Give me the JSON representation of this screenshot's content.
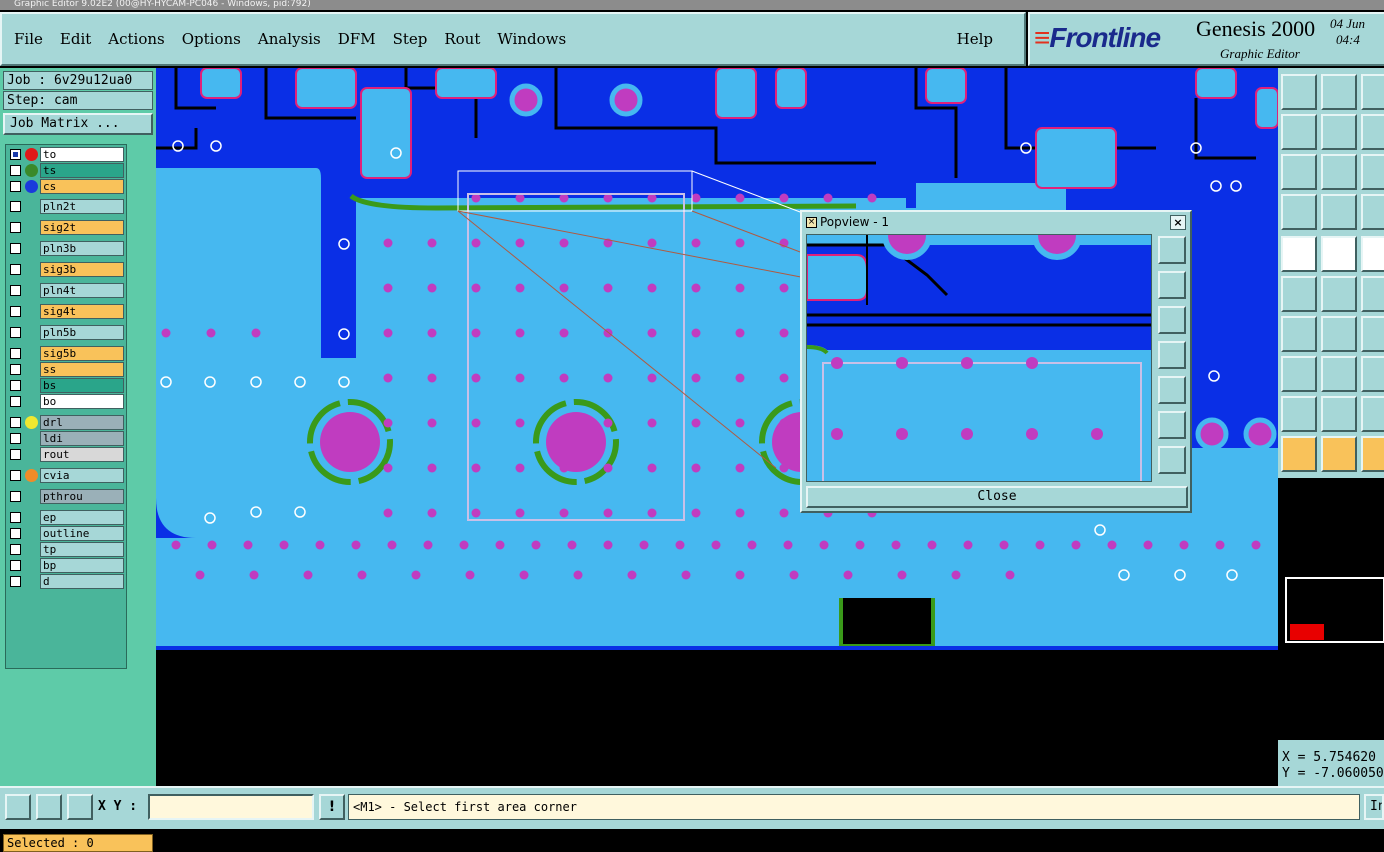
{
  "window_title": "Graphic Editor 9.02E2 (00@HY-HYCAM-PC046 - Windows, pid:792)",
  "menu": [
    "File",
    "Edit",
    "Actions",
    "Options",
    "Analysis",
    "DFM",
    "Step",
    "Rout",
    "Windows"
  ],
  "help_label": "Help",
  "brand": {
    "logo_text": "Frontline",
    "product": "Genesis 2000",
    "subtitle": "Graphic Editor",
    "date_line1": "04 Jun",
    "date_line2": "04:4"
  },
  "job_label": "Job : 6v29u12ua0",
  "step_label": "Step: cam",
  "job_matrix_button": "Job Matrix ...",
  "layers": [
    {
      "name": "to",
      "checked": true,
      "dot": "#e01818",
      "bg": "#ffffff"
    },
    {
      "name": "ts",
      "checked": false,
      "dot": "#3a8a2a",
      "bg": "#2aa58a"
    },
    {
      "name": "cs",
      "checked": false,
      "dot": "#1a3adc",
      "bg": "#f9c25a"
    },
    {
      "name": "pln2t",
      "checked": false,
      "dot": "",
      "bg": "#a6d7d7"
    },
    {
      "name": "sig2t",
      "checked": false,
      "dot": "",
      "bg": "#f9c25a"
    },
    {
      "name": "pln3b",
      "checked": false,
      "dot": "",
      "bg": "#a6d7d7"
    },
    {
      "name": "sig3b",
      "checked": false,
      "dot": "",
      "bg": "#f9c25a"
    },
    {
      "name": "pln4t",
      "checked": false,
      "dot": "",
      "bg": "#a6d7d7"
    },
    {
      "name": "sig4t",
      "checked": false,
      "dot": "",
      "bg": "#f9c25a"
    },
    {
      "name": "pln5b",
      "checked": false,
      "dot": "",
      "bg": "#a6d7d7"
    },
    {
      "name": "sig5b",
      "checked": false,
      "dot": "",
      "bg": "#f9c25a"
    },
    {
      "name": "ss",
      "checked": false,
      "dot": "",
      "bg": "#f9c25a"
    },
    {
      "name": "bs",
      "checked": false,
      "dot": "",
      "bg": "#2aa58a"
    },
    {
      "name": "bo",
      "checked": false,
      "dot": "",
      "bg": "#ffffff"
    },
    {
      "name": "drl",
      "checked": false,
      "dot": "#f0e830",
      "bg": "#9ab0b8"
    },
    {
      "name": "ldi",
      "checked": false,
      "dot": "",
      "bg": "#9ab0b8"
    },
    {
      "name": "rout",
      "checked": false,
      "dot": "",
      "bg": "#d8d8d8"
    },
    {
      "name": "cvia",
      "checked": false,
      "dot": "#f08c28",
      "bg": "#a6d7d7"
    },
    {
      "name": "pthrou",
      "checked": false,
      "dot": "",
      "bg": "#9ab0b8"
    },
    {
      "name": "ep",
      "checked": false,
      "dot": "",
      "bg": "#a6d7d7"
    },
    {
      "name": "outline",
      "checked": false,
      "dot": "",
      "bg": "#a6d7d7"
    },
    {
      "name": "tp",
      "checked": false,
      "dot": "",
      "bg": "#a6d7d7"
    },
    {
      "name": "bp",
      "checked": false,
      "dot": "",
      "bg": "#a6d7d7"
    },
    {
      "name": "d",
      "checked": false,
      "dot": "",
      "bg": "#a6d7d7"
    }
  ],
  "selected_label": "Selected : 0",
  "popview": {
    "title": "Popview - 1",
    "close_label": "Close"
  },
  "coords": {
    "x": "X = 5.754620",
    "y": "Y = -7.060050"
  },
  "xy_label": "X Y :",
  "xy_value": "",
  "status_text": "<M1> - Select first area corner",
  "right_button": "In",
  "colors": {
    "board_blue": "#0a2fe6",
    "copper": "#46b8f0",
    "pad_magenta": "#c03cc0",
    "outline_green": "#3a9a1a",
    "ui_teal": "#a6d7d7",
    "layer_panel": "#5ecba8"
  }
}
